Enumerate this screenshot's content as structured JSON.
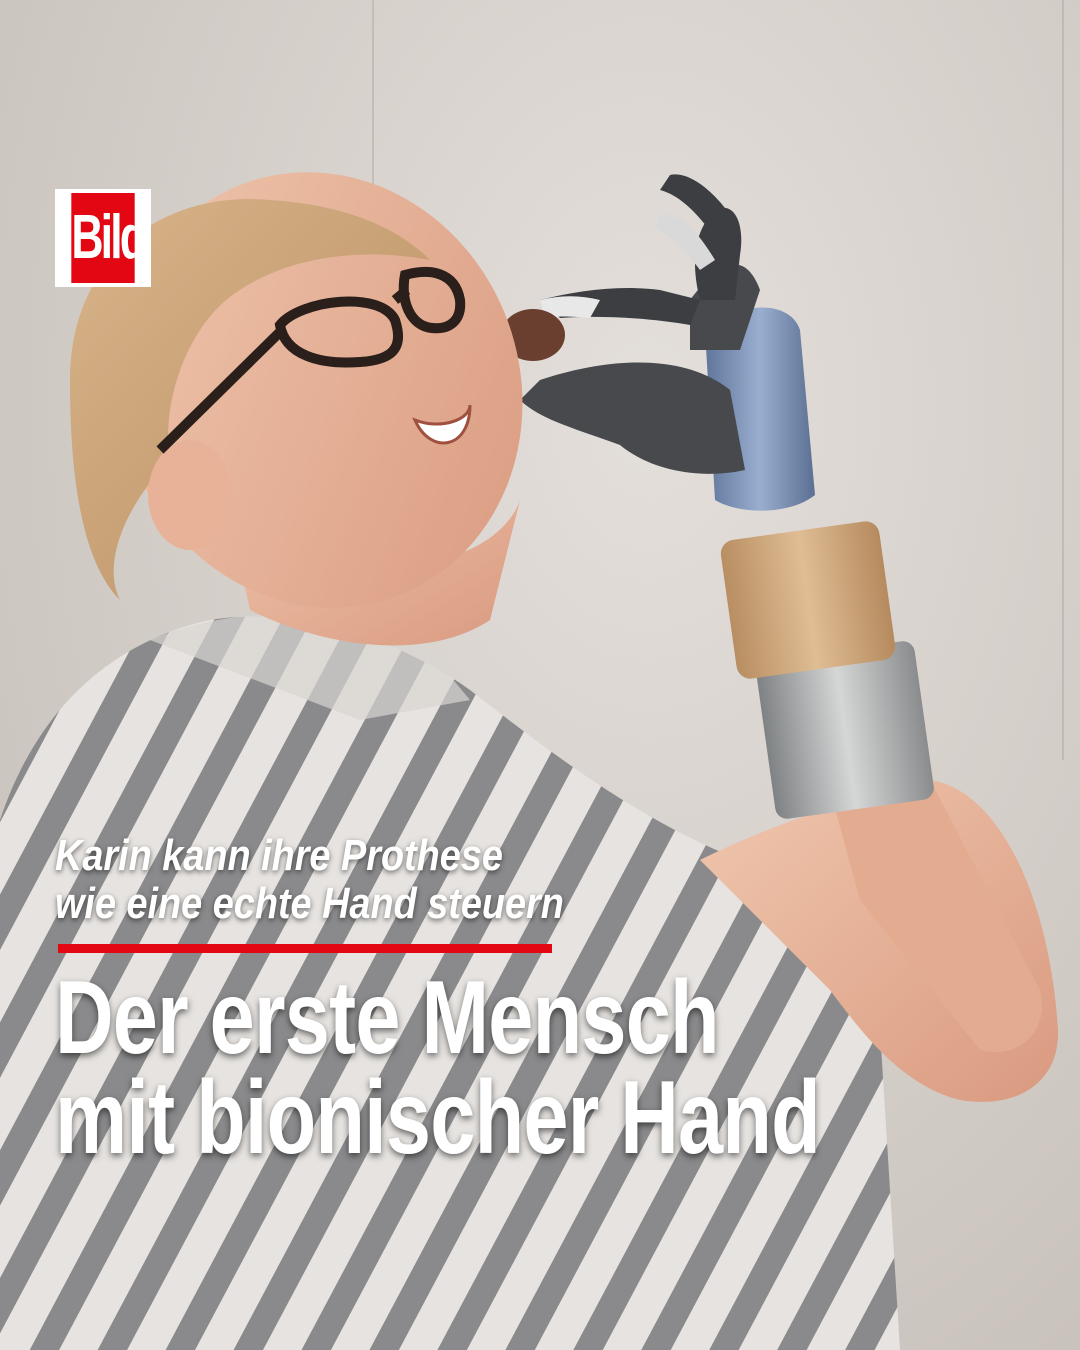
{
  "brand": {
    "logo_text": "Bild",
    "logo_color": "#e30613"
  },
  "kicker": {
    "line1": "Karin kann ihre Prothese",
    "line2": "wie eine echte Hand steuern"
  },
  "headline": {
    "line1": "Der erste Mensch",
    "line2": "mit bionischer Hand"
  },
  "colors": {
    "accent": "#e30613",
    "text": "#ffffff"
  }
}
